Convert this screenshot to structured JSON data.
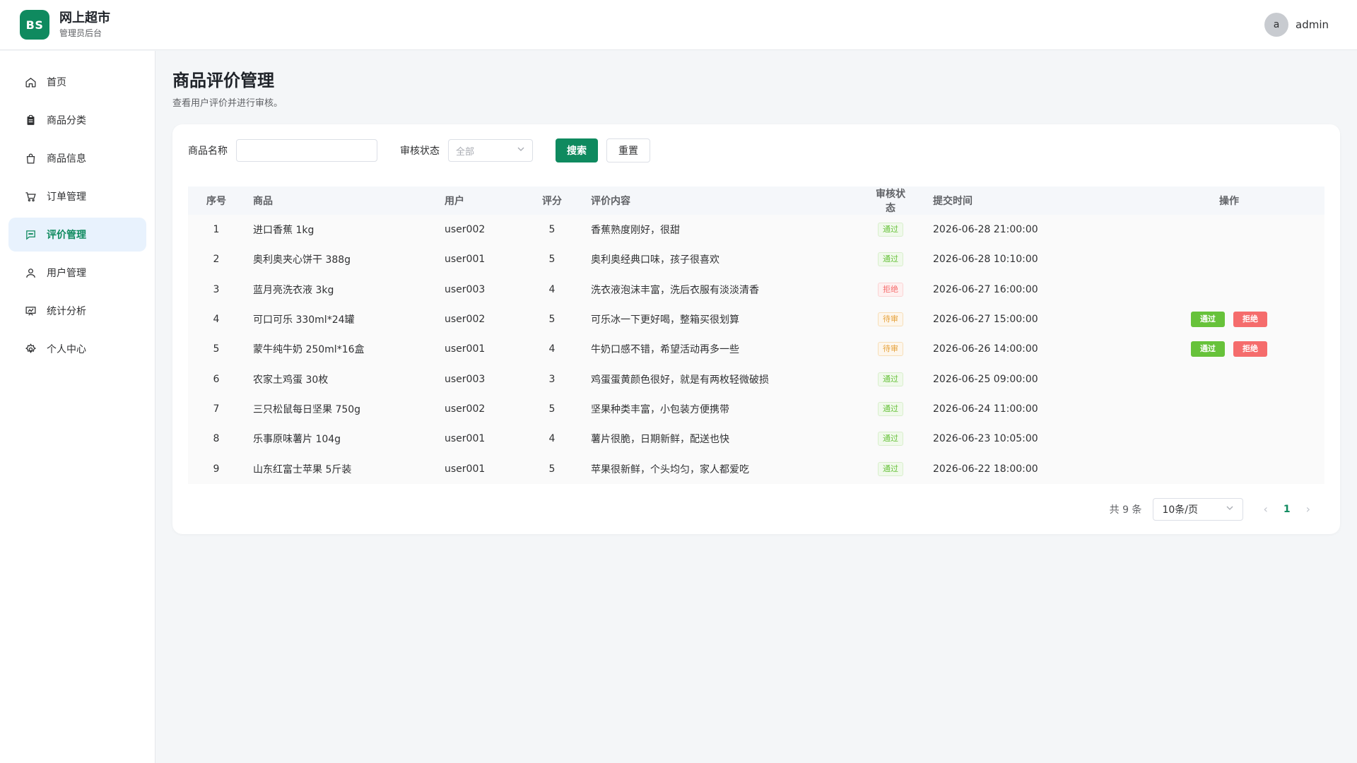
{
  "header": {
    "logo": "BS",
    "title": "网上超市",
    "subtitle": "管理员后台",
    "avatar": "a",
    "user": "admin"
  },
  "sidebar": {
    "items": [
      {
        "label": "首页",
        "icon": "home-icon"
      },
      {
        "label": "商品分类",
        "icon": "clipboard-icon"
      },
      {
        "label": "商品信息",
        "icon": "bag-icon"
      },
      {
        "label": "订单管理",
        "icon": "cart-icon"
      },
      {
        "label": "评价管理",
        "icon": "chat-icon",
        "active": true
      },
      {
        "label": "用户管理",
        "icon": "user-icon"
      },
      {
        "label": "统计分析",
        "icon": "chart-icon"
      },
      {
        "label": "个人中心",
        "icon": "gear-icon"
      }
    ]
  },
  "page": {
    "title": "商品评价管理",
    "description": "查看用户评价并进行审核。"
  },
  "filter": {
    "name_label": "商品名称",
    "status_label": "审核状态",
    "status_value": "全部",
    "search": "搜索",
    "reset": "重置"
  },
  "table": {
    "headers": [
      "序号",
      "商品",
      "用户",
      "评分",
      "评价内容",
      "审核状态",
      "提交时间",
      "操作"
    ],
    "rows": [
      {
        "idx": "1",
        "goods": "进口香蕉 1kg",
        "user": "user002",
        "score": "5",
        "content": "香蕉熟度刚好，很甜",
        "status": "通过",
        "time": "2026-06-28 21:00:00"
      },
      {
        "idx": "2",
        "goods": "奥利奥夹心饼干 388g",
        "user": "user001",
        "score": "5",
        "content": "奥利奥经典口味，孩子很喜欢",
        "status": "通过",
        "time": "2026-06-28 10:10:00"
      },
      {
        "idx": "3",
        "goods": "蓝月亮洗衣液 3kg",
        "user": "user003",
        "score": "4",
        "content": "洗衣液泡沫丰富，洗后衣服有淡淡清香",
        "status": "拒绝",
        "time": "2026-06-27 16:00:00"
      },
      {
        "idx": "4",
        "goods": "可口可乐 330ml*24罐",
        "user": "user002",
        "score": "5",
        "content": "可乐冰一下更好喝，整箱买很划算",
        "status": "待审",
        "time": "2026-06-27 15:00:00"
      },
      {
        "idx": "5",
        "goods": "蒙牛纯牛奶 250ml*16盒",
        "user": "user001",
        "score": "4",
        "content": "牛奶口感不错，希望活动再多一些",
        "status": "待审",
        "time": "2026-06-26 14:00:00"
      },
      {
        "idx": "6",
        "goods": "农家土鸡蛋 30枚",
        "user": "user003",
        "score": "3",
        "content": "鸡蛋蛋黄颜色很好，就是有两枚轻微破损",
        "status": "通过",
        "time": "2026-06-25 09:00:00"
      },
      {
        "idx": "7",
        "goods": "三只松鼠每日坚果 750g",
        "user": "user002",
        "score": "5",
        "content": "坚果种类丰富，小包装方便携带",
        "status": "通过",
        "time": "2026-06-24 11:00:00"
      },
      {
        "idx": "8",
        "goods": "乐事原味薯片 104g",
        "user": "user001",
        "score": "4",
        "content": "薯片很脆，日期新鲜，配送也快",
        "status": "通过",
        "time": "2026-06-23 10:05:00"
      },
      {
        "idx": "9",
        "goods": "山东红富士苹果 5斤装",
        "user": "user001",
        "score": "5",
        "content": "苹果很新鲜，个头均匀，家人都爱吃",
        "status": "通过",
        "time": "2026-06-22 18:00:00"
      }
    ],
    "op_pass": "通过",
    "op_reject": "拒绝"
  },
  "pager": {
    "total": "共 9 条",
    "size": "10条/页",
    "page": "1"
  },
  "colors": {
    "brand": "#0f8a5f",
    "pass": "#67c23a",
    "reject": "#f56c6c",
    "pending": "#e6a23c"
  }
}
